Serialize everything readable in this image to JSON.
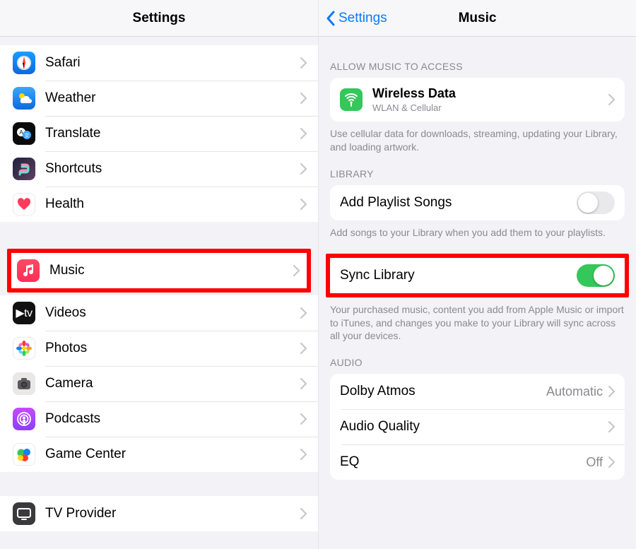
{
  "left": {
    "title": "Settings",
    "groups": [
      {
        "items": [
          {
            "key": "safari",
            "label": "Safari",
            "iconClass": "ic-safari",
            "iconSvg": "compass"
          },
          {
            "key": "weather",
            "label": "Weather",
            "iconClass": "ic-weather",
            "iconSvg": "cloud-sun"
          },
          {
            "key": "translate",
            "label": "Translate",
            "iconClass": "ic-translate",
            "iconSvg": "translate"
          },
          {
            "key": "shortcuts",
            "label": "Shortcuts",
            "iconClass": "ic-shortcuts",
            "iconSvg": "shortcuts"
          },
          {
            "key": "health",
            "label": "Health",
            "iconClass": "ic-health",
            "iconSvg": "heart"
          }
        ]
      },
      {
        "items": [
          {
            "key": "music",
            "label": "Music",
            "iconClass": "ic-music",
            "iconSvg": "note",
            "highlighted": true
          },
          {
            "key": "videos",
            "label": "Videos",
            "iconClass": "ic-videos",
            "iconText": "▶tv"
          },
          {
            "key": "photos",
            "label": "Photos",
            "iconClass": "ic-photos",
            "iconSvg": "flower"
          },
          {
            "key": "camera",
            "label": "Camera",
            "iconClass": "ic-camera",
            "iconSvg": "camera"
          },
          {
            "key": "podcasts",
            "label": "Podcasts",
            "iconClass": "ic-podcasts",
            "iconSvg": "podcast"
          },
          {
            "key": "gamecenter",
            "label": "Game Center",
            "iconClass": "ic-gamecenter",
            "iconSvg": "bubbles"
          }
        ]
      },
      {
        "items": [
          {
            "key": "tvprovider",
            "label": "TV Provider",
            "iconClass": "ic-tvprovider",
            "iconSvg": "tv"
          }
        ]
      }
    ]
  },
  "right": {
    "back": "Settings",
    "title": "Music",
    "sections": [
      {
        "header": "Allow Music to Access",
        "rows": [
          {
            "type": "nav-sub",
            "key": "wireless",
            "label": "Wireless Data",
            "sublabel": "WLAN & Cellular",
            "iconClass": "ic-wireless",
            "iconSvg": "antenna"
          }
        ],
        "footer": "Use cellular data for downloads, streaming, updating your Library, and loading artwork."
      },
      {
        "header": "Library",
        "rows": [
          {
            "type": "toggle",
            "key": "addplaylist",
            "label": "Add Playlist Songs",
            "on": false
          }
        ],
        "footer": "Add songs to your Library when you add them to your playlists."
      },
      {
        "rows": [
          {
            "type": "toggle",
            "key": "synclibrary",
            "label": "Sync Library",
            "on": true,
            "highlighted": true
          }
        ],
        "footer": "Your purchased music, content you add from Apple Music or import to iTunes, and changes you make to your Library will sync across all your devices."
      },
      {
        "header": "Audio",
        "rows": [
          {
            "type": "nav",
            "key": "dolby",
            "label": "Dolby Atmos",
            "detail": "Automatic"
          },
          {
            "type": "nav",
            "key": "quality",
            "label": "Audio Quality",
            "detail": ""
          },
          {
            "type": "nav",
            "key": "eq",
            "label": "EQ",
            "detail": "Off"
          }
        ]
      }
    ]
  }
}
